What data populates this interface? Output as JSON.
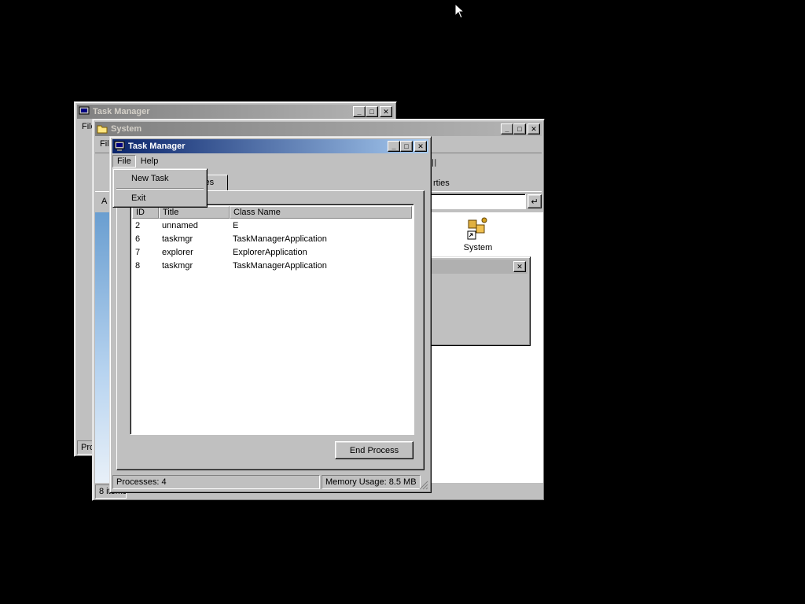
{
  "back_window": {
    "title": "Task Manager",
    "menu_first": "File",
    "status_fragment": "Pro"
  },
  "system_window": {
    "title": "System",
    "menu_first": "File",
    "address_label": "A",
    "toolbar_fragment": "rties",
    "icon_label": "System",
    "item_count": "8 items",
    "go_icon": "↵",
    "dialog_close": "✕"
  },
  "task_manager": {
    "title": "Task Manager",
    "menu": [
      "File",
      "Help"
    ],
    "file_menu": {
      "items": [
        "New Task",
        "Exit"
      ]
    },
    "tab_label": "Processes",
    "tab_label_visible": "ses",
    "columns": [
      "ID",
      "Title",
      "Class Name"
    ],
    "processes": [
      {
        "id": "2",
        "title": "unnamed",
        "class": "E"
      },
      {
        "id": "6",
        "title": "taskmgr",
        "class": "TaskManagerApplication"
      },
      {
        "id": "7",
        "title": "explorer",
        "class": "ExplorerApplication"
      },
      {
        "id": "8",
        "title": "taskmgr",
        "class": "TaskManagerApplication"
      }
    ],
    "end_process_label": "End Process",
    "status": {
      "processes": "Processes: 4",
      "memory": "Memory Usage: 8.5 MB"
    }
  },
  "titlebar_buttons": {
    "minimize": "_",
    "maximize": "□",
    "close": "✕"
  },
  "colors": {
    "desktop": "#000000",
    "face": "#c0c0c0",
    "active_title_start": "#0a246a",
    "active_title_end": "#a6caf0",
    "inactive_title": "#808080"
  }
}
